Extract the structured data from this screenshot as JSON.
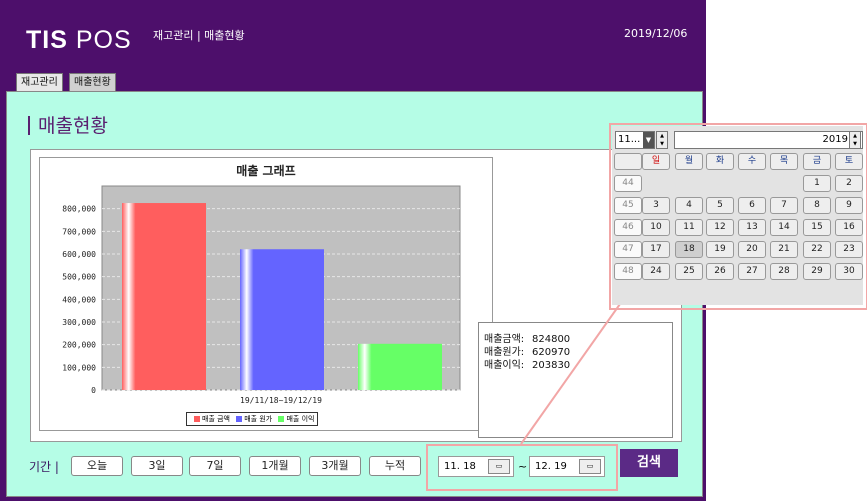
{
  "app": {
    "logo_bold": "TIS",
    "logo_light": " POS",
    "title": "재고관리 | 매출현황",
    "date": "2019/12/06"
  },
  "tabs": [
    {
      "label": "재고관리"
    },
    {
      "label": "매출현황"
    }
  ],
  "page": {
    "title": "매출현황"
  },
  "chart_data": {
    "type": "bar",
    "title": "매출 그래프",
    "categories": [
      "19/11/18~19/12/19"
    ],
    "series": [
      {
        "name": "매출 금액",
        "values": [
          824800
        ],
        "color": "#ff5e5e"
      },
      {
        "name": "매출 원가",
        "values": [
          620970
        ],
        "color": "#6464ff"
      },
      {
        "name": "매출 이익",
        "values": [
          203830
        ],
        "color": "#66ff66"
      }
    ],
    "ylim": [
      0,
      900000
    ],
    "yticks": [
      "0",
      "100,000",
      "200,000",
      "300,000",
      "400,000",
      "500,000",
      "600,000",
      "700,000",
      "800,000"
    ],
    "grid": true,
    "legend": "bottom"
  },
  "summary": [
    {
      "key": "매출금액:",
      "value": "824800"
    },
    {
      "key": "매출원가:",
      "value": "620970"
    },
    {
      "key": "매출이익:",
      "value": "203830"
    }
  ],
  "period": {
    "label": "기간 |",
    "buttons": [
      "오늘",
      "3일",
      "7일",
      "1개월",
      "3개월",
      "누적"
    ],
    "start": "11. 18",
    "end": "12. 19",
    "tilde": "~",
    "search": "검색"
  },
  "calendar": {
    "month": "11...",
    "year": "2019",
    "headers": [
      "",
      "일",
      "월",
      "화",
      "수",
      "목",
      "금",
      "토"
    ],
    "weeks": [
      [
        "44",
        "",
        "",
        "",
        "",
        "",
        "1",
        "2"
      ],
      [
        "45",
        "3",
        "4",
        "5",
        "6",
        "7",
        "8",
        "9"
      ],
      [
        "46",
        "10",
        "11",
        "12",
        "13",
        "14",
        "15",
        "16"
      ],
      [
        "47",
        "17",
        "18",
        "19",
        "20",
        "21",
        "22",
        "23"
      ],
      [
        "48",
        "24",
        "25",
        "26",
        "27",
        "28",
        "29",
        "30"
      ]
    ],
    "selected": "18",
    "colors": {
      "sunday": "#d01010",
      "weekday": "#1a3a8a",
      "saturday": "#1a3a8a"
    }
  },
  "colors": {
    "header": "#4d0f6b",
    "content": "#b5fde6",
    "accent": "#5b2a86",
    "highlight": "#f2a6a6"
  }
}
